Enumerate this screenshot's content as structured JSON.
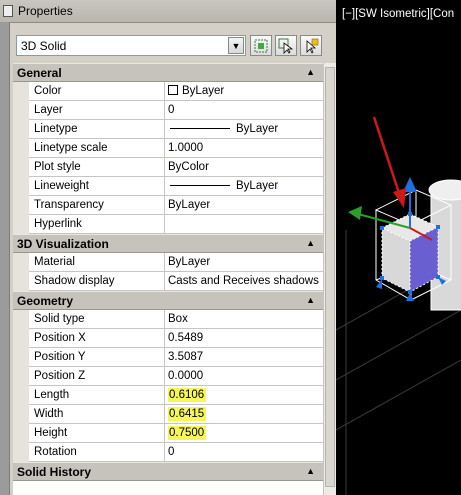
{
  "palette": {
    "title": "Properties",
    "selector": {
      "value": "3D Solid"
    },
    "toolbar_icons": [
      "quick-select-icon",
      "select-objects-icon",
      "toggle-pickadd-icon"
    ]
  },
  "sections": {
    "general": {
      "title": "General",
      "rows": [
        {
          "label": "Color",
          "value": "ByLayer"
        },
        {
          "label": "Layer",
          "value": "0"
        },
        {
          "label": "Linetype",
          "value": "ByLayer"
        },
        {
          "label": "Linetype scale",
          "value": "1.0000"
        },
        {
          "label": "Plot style",
          "value": "ByColor"
        },
        {
          "label": "Lineweight",
          "value": "ByLayer"
        },
        {
          "label": "Transparency",
          "value": "ByLayer"
        },
        {
          "label": "Hyperlink",
          "value": ""
        }
      ]
    },
    "visualization": {
      "title": "3D Visualization",
      "rows": [
        {
          "label": "Material",
          "value": "ByLayer"
        },
        {
          "label": "Shadow display",
          "value": "Casts and Receives shadows"
        }
      ]
    },
    "geometry": {
      "title": "Geometry",
      "rows": [
        {
          "label": "Solid type",
          "value": "Box"
        },
        {
          "label": "Position X",
          "value": "0.5489"
        },
        {
          "label": "Position Y",
          "value": "3.5087"
        },
        {
          "label": "Position Z",
          "value": "0.0000"
        },
        {
          "label": "Length",
          "value": "0.6106"
        },
        {
          "label": "Width",
          "value": "0.6415"
        },
        {
          "label": "Height",
          "value": "0.7500"
        },
        {
          "label": "Rotation",
          "value": "0"
        }
      ]
    },
    "history": {
      "title": "Solid History"
    }
  },
  "viewport": {
    "label": "[−][SW Isometric][Con"
  },
  "colors": {
    "highlight": "#f6f65a",
    "section_bg": "#c6c3bc",
    "grip_blue": "#1e6fe0",
    "face_purple": "#6a5fd0",
    "arrow_red": "#d01818"
  }
}
